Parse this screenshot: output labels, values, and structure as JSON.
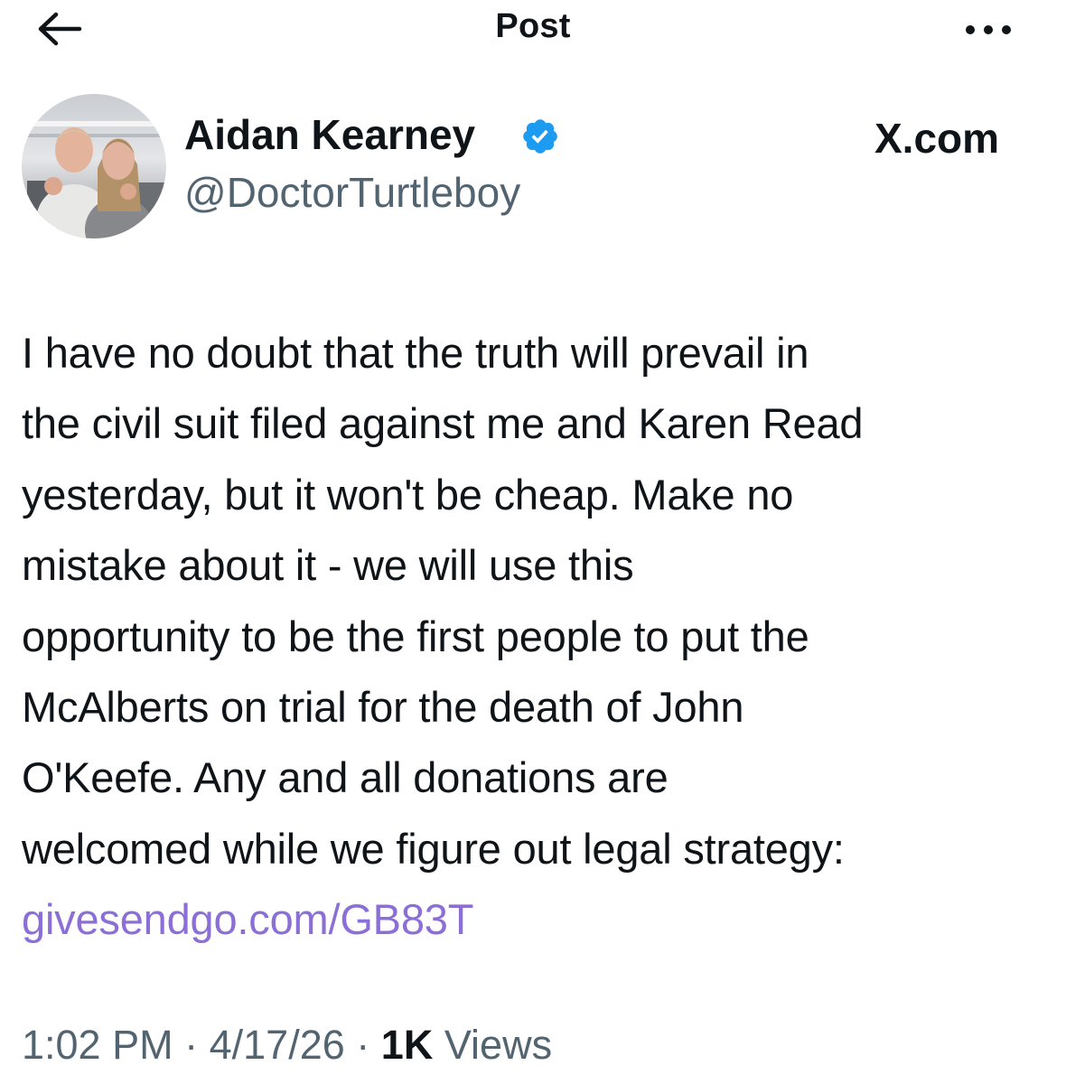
{
  "header": {
    "title": "Post",
    "back_icon": "arrow-left-icon",
    "more_icon": "more-horizontal-icon"
  },
  "author": {
    "display_name": "Aidan Kearney",
    "handle": "@DoctorTurtleboy",
    "verified_icon": "verified-badge-icon",
    "verified_color": "#1d9bf0"
  },
  "source_label": "X.com",
  "post": {
    "lines": [
      "I have no doubt that the truth will prevail in",
      "the civil suit filed against me and Karen Read",
      "yesterday, but it won't be cheap. Make no",
      "mistake about it - we will use this",
      "opportunity to be the first people to put the",
      "McAlberts on trial for the death of John",
      "O'Keefe. Any and all donations are",
      "welcomed while we figure out legal strategy:"
    ],
    "link": "givesendgo.com/GB83T",
    "link_color": "#8b6fd6"
  },
  "meta": {
    "time": "1:02 PM",
    "sep1": "·",
    "date": "4/17/26",
    "sep2": "·",
    "views_count": "1K",
    "views_label": "Views"
  }
}
